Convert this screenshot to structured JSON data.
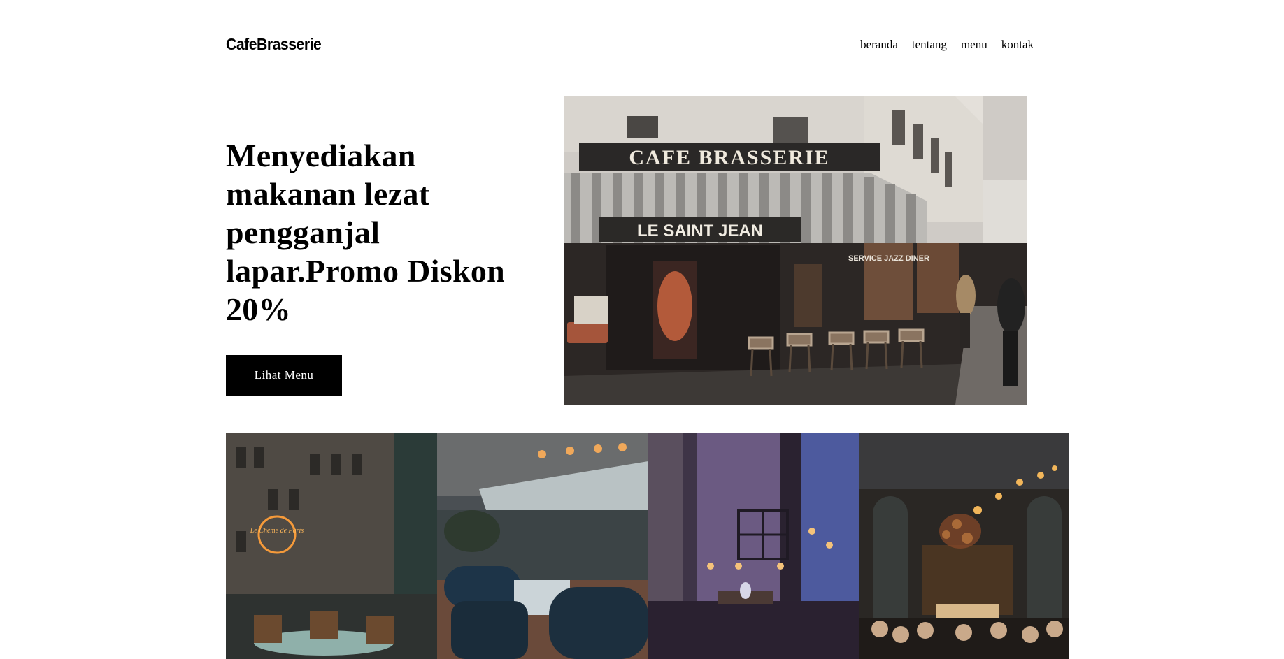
{
  "header": {
    "logo": "CafeBrasserie",
    "nav": [
      "beranda",
      "tentang",
      "menu",
      "kontak"
    ]
  },
  "hero": {
    "title": "Menyediakan makanan lezat pengganjal lapar.Promo Diskon 20%",
    "button_label": "Lihat Menu",
    "image_sign_top": "CAFE  BRASSERIE",
    "image_sign_bottom": "LE SAINT JEAN",
    "image_window_sign": "SERVICE JAZZ DINER",
    "neon_sign": "Le Chéme de Paris"
  },
  "gallery": {
    "items": [
      "street-cafe-neon",
      "terrace-chairs",
      "purple-interior",
      "chandelier-dining"
    ]
  },
  "colors": {
    "background": "#ffffff",
    "text": "#000000",
    "button_bg": "#000000",
    "button_text": "#ffffff"
  }
}
